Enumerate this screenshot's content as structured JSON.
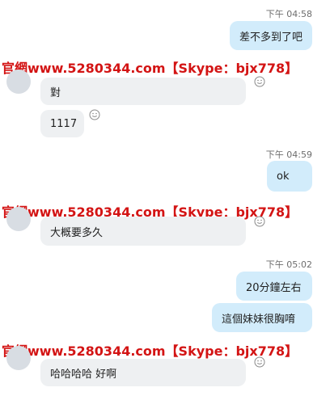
{
  "watermark": "官網www.5280344.com【Skype：bjx778】",
  "messages": [
    {
      "time": "下午 04:58",
      "text": "差不多到了吧"
    },
    {
      "text": "對"
    },
    {
      "text": "1117"
    },
    {
      "time": "下午 04:59",
      "text": "ok"
    },
    {
      "text": "大概要多久"
    },
    {
      "time": "下午 05:02",
      "text": "20分鐘左右"
    },
    {
      "text": "這個妹妹很胸唷"
    },
    {
      "text": "哈哈哈哈 好啊"
    }
  ],
  "colors": {
    "outgoing_bubble": "#d2ecfb",
    "incoming_bubble": "#eef0f2",
    "watermark": "#d31414"
  },
  "icons": {
    "reaction": "smiley-icon",
    "avatar": "avatar"
  }
}
